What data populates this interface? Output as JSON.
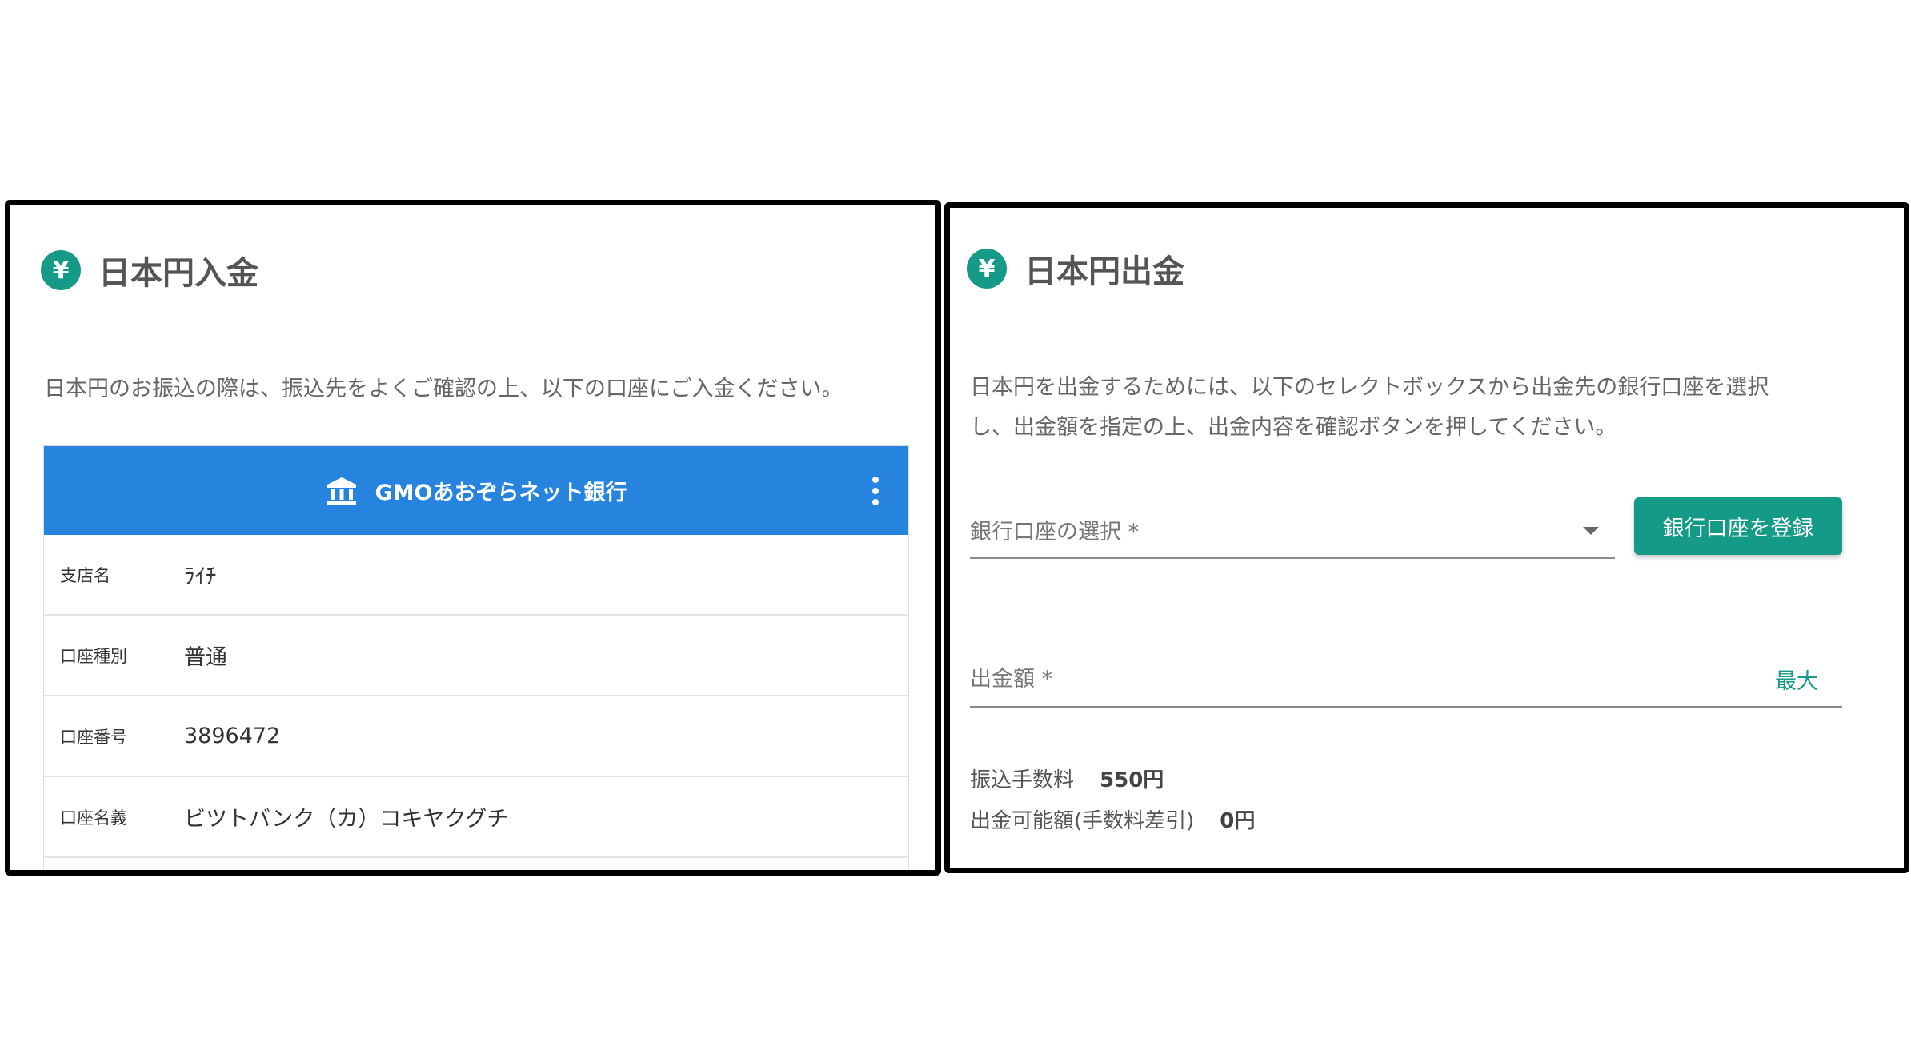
{
  "deposit": {
    "icon_glyph": "¥",
    "title": "日本円入金",
    "description": "日本円のお振込の際は、振込先をよくご確認の上、以下の口座にご入金ください。",
    "bank_name": "GMOあおぞらネット銀行",
    "rows": [
      {
        "label": "支店名",
        "value": "ﾗｲﾁ"
      },
      {
        "label": "口座種別",
        "value": "普通"
      },
      {
        "label": "口座番号",
        "value": "3896472"
      },
      {
        "label": "口座名義",
        "value": "ビツトバンク（カ）コキヤクグチ"
      }
    ]
  },
  "withdraw": {
    "icon_glyph": "¥",
    "title": "日本円出金",
    "description_line1": "日本円を出金するためには、以下のセレクトボックスから出金先の銀行口座を選択",
    "description_line2": "し、出金額を指定の上、出金内容を確認ボタンを押してください。",
    "bank_select_label": "銀行口座の選択 *",
    "register_button": "銀行口座を登録",
    "amount_label": "出金額 *",
    "max_label": "最大",
    "fee_label": "振込手数料",
    "fee_value": "550円",
    "available_label": "出金可能額(手数料差引)",
    "available_value": "0円"
  },
  "colors": {
    "accent": "#159a87",
    "bank_header": "#2684de"
  }
}
